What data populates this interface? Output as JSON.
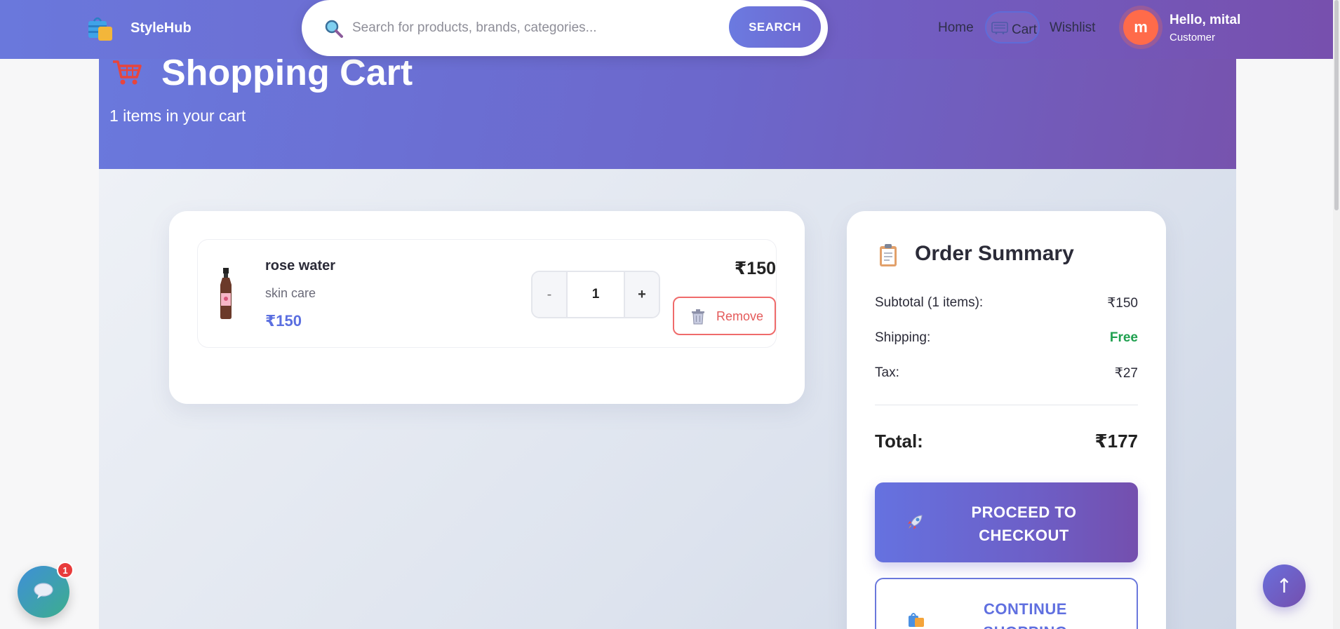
{
  "navbar": {
    "brand": "StyleHub",
    "search": {
      "placeholder": "Search for products, brands, categories...",
      "button_label": "SEARCH"
    },
    "links": {
      "home": "Home",
      "cart": "Cart",
      "wishlist": "Wishlist"
    },
    "user": {
      "avatar_letter": "m",
      "greeting": "Hello, mital",
      "role": "Customer"
    }
  },
  "hero": {
    "title": "Shopping Cart",
    "subtitle": "1 items in your cart"
  },
  "cart": {
    "items": [
      {
        "name": "rose water",
        "category": "skin care",
        "unit_price": "₹150",
        "quantity": "1",
        "line_total": "₹150",
        "minus_label": "-",
        "plus_label": "+",
        "remove_label": "Remove"
      }
    ]
  },
  "summary": {
    "title": "Order Summary",
    "subtotal_label": "Subtotal (1 items):",
    "subtotal_value": "₹150",
    "shipping_label": "Shipping:",
    "shipping_value": "Free",
    "tax_label": "Tax:",
    "tax_value": "₹27",
    "total_label": "Total:",
    "total_value": "₹177",
    "checkout_label": "PROCEED TO CHECKOUT",
    "continue_label": "CONTINUE SHOPPING"
  },
  "floating": {
    "chat_badge": "1",
    "scroll_top_label": "↑"
  },
  "colors": {
    "brand_primary": "#6a78dc",
    "brand_secondary": "#7750ae",
    "price_accent": "#5b6fe0",
    "remove": "#ef6b6b",
    "free": "#1fa04f"
  }
}
